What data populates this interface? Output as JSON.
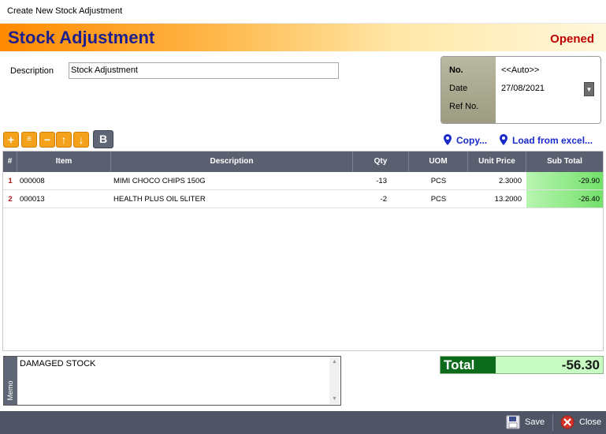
{
  "window": {
    "title": "Create New Stock Adjustment"
  },
  "banner": {
    "title": "Stock Adjustment",
    "status": "Opened"
  },
  "form": {
    "description_label": "Description",
    "description_value": "Stock Adjustment",
    "no_label": "No.",
    "no_value": "<<Auto>>",
    "date_label": "Date",
    "date_value": "27/08/2021",
    "ref_label": "Ref No.",
    "ref_value": ""
  },
  "toolbar": {
    "icons": [
      "add-icon",
      "insert-icon",
      "remove-icon",
      "move-up-icon",
      "move-down-icon"
    ],
    "bold_label": "B",
    "copy_label": "Copy...",
    "load_label": "Load from excel..."
  },
  "grid": {
    "columns": [
      "#",
      "Item",
      "Description",
      "Qty",
      "UOM",
      "Unit Price",
      "Sub Total"
    ],
    "rows": [
      {
        "idx": "1",
        "item": "000008",
        "description": "MIMI CHOCO CHIPS 150G",
        "qty": "-13",
        "uom": "PCS",
        "unit_price": "2.3000",
        "sub_total": "-29.90"
      },
      {
        "idx": "2",
        "item": "000013",
        "description": "HEALTH PLUS OIL 5LITER",
        "qty": "-2",
        "uom": "PCS",
        "unit_price": "13.2000",
        "sub_total": "-26.40"
      }
    ]
  },
  "memo": {
    "label": "Memo",
    "value": "DAMAGED STOCK"
  },
  "total": {
    "label": "Total",
    "value": "-56.30"
  },
  "footer": {
    "save_label": "Save",
    "close_label": "Close"
  },
  "colors": {
    "accent": "#f4a11b",
    "title": "#1b1f8f",
    "status": "#c00000",
    "grid_header": "#5a6070",
    "total_bg": "#0b6b1a"
  }
}
